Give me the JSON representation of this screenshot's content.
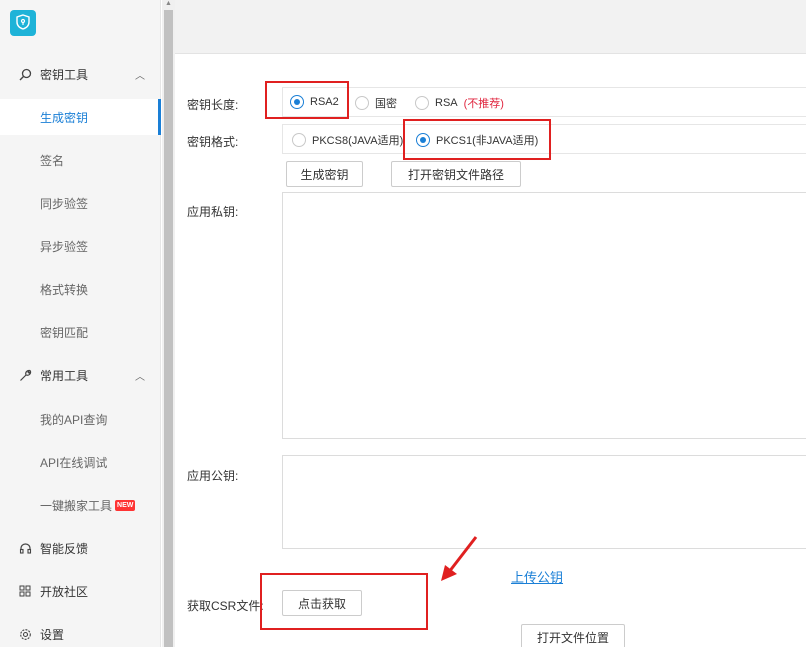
{
  "colors": {
    "accent": "#1a7fd6",
    "warning": "#e0263f",
    "annotation": "#e02020",
    "logo": "#1eb3d8"
  },
  "sidebar": {
    "logo_icon": "shield-icon",
    "groups": [
      {
        "label": "密钥工具",
        "icon": "search-icon",
        "expanded": true
      },
      {
        "label": "常用工具",
        "icon": "wrench-icon",
        "expanded": true
      },
      {
        "label": "智能反馈",
        "icon": "headset-icon"
      },
      {
        "label": "开放社区",
        "icon": "grid-icon"
      },
      {
        "label": "设置",
        "icon": "gear-icon"
      }
    ],
    "key_items": [
      "生成密钥",
      "签名",
      "同步验签",
      "异步验签",
      "格式转换",
      "密钥匹配"
    ],
    "tool_items": [
      "我的API查询",
      "API在线调试",
      "一键搬家工具"
    ],
    "new_badge": "NEW"
  },
  "form": {
    "key_length_label": "密钥长度:",
    "key_length_options": {
      "rsa2": "RSA2",
      "guomi": "国密",
      "rsa": "RSA",
      "rsa_note": "(不推荐)"
    },
    "key_length_selected": "RSA2",
    "key_format_label": "密钥格式:",
    "key_format_options": {
      "pkcs8": "PKCS8(JAVA适用)",
      "pkcs1": "PKCS1(非JAVA适用)"
    },
    "key_format_selected": "PKCS1(非JAVA适用)",
    "generate_button": "生成密钥",
    "open_path_button": "打开密钥文件路径",
    "private_key_label": "应用私钥:",
    "private_key_value": "",
    "public_key_label": "应用公钥:",
    "public_key_value": "",
    "upload_link": "上传公钥",
    "csr_label": "获取CSR文件:",
    "csr_button": "点击获取",
    "open_location_button": "打开文件位置"
  }
}
